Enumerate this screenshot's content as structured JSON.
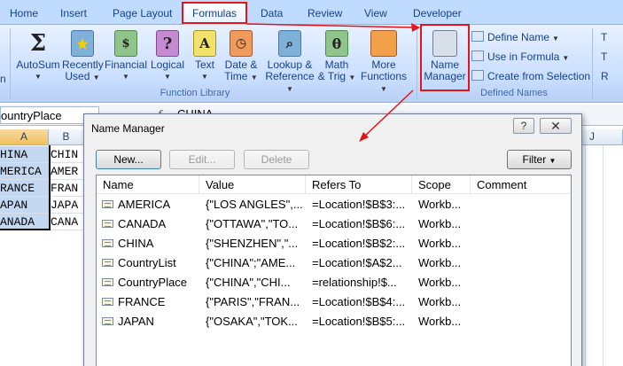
{
  "tabs": [
    "Home",
    "Insert",
    "Page Layout",
    "Formulas",
    "Data",
    "Review",
    "View",
    "Developer"
  ],
  "ribbon": {
    "partial_left": "n",
    "function_library": {
      "buttons": [
        {
          "line1": "AutoSum",
          "line2": "",
          "icon": "sigma-icon"
        },
        {
          "line1": "Recently",
          "line2": "Used",
          "icon": "star-book-icon"
        },
        {
          "line1": "Financial",
          "line2": "",
          "icon": "money-book-icon"
        },
        {
          "line1": "Logical",
          "line2": "",
          "icon": "question-book-icon"
        },
        {
          "line1": "Text",
          "line2": "",
          "icon": "text-book-icon"
        },
        {
          "line1": "Date &",
          "line2": "Time",
          "icon": "clock-book-icon"
        },
        {
          "line1": "Lookup &",
          "line2": "Reference",
          "icon": "magnifier-book-icon"
        },
        {
          "line1": "Math",
          "line2": "& Trig",
          "icon": "theta-book-icon"
        },
        {
          "line1": "More",
          "line2": "Functions",
          "icon": "more-books-icon"
        }
      ],
      "label": "Function Library"
    },
    "defined_names": {
      "name_manager_line1": "Name",
      "name_manager_line2": "Manager",
      "define_name": "Define Name",
      "use_in_formula": "Use in Formula",
      "create_from_selection": "Create from Selection",
      "label": "Defined Names"
    },
    "partial_right": [
      "T",
      "T",
      "R"
    ]
  },
  "formula_bar": {
    "name_box": "ountryPlace",
    "fx": "f",
    "value": "CHINA"
  },
  "sheet": {
    "col_a": "A",
    "col_b": "B",
    "col_j": "J",
    "col_a_cells": [
      "HINA",
      "MERICA",
      "RANCE",
      "APAN",
      "ANADA"
    ],
    "col_b_cells": [
      "CHIN",
      "AMER",
      "FRAN",
      "JAPA",
      "CANA"
    ]
  },
  "dialog": {
    "title": "Name Manager",
    "help": "?",
    "close": "✕",
    "new_button": "New...",
    "edit_button": "Edit...",
    "delete_button": "Delete",
    "filter_button": "Filter",
    "columns": [
      "Name",
      "Value",
      "Refers To",
      "Scope",
      "Comment"
    ],
    "rows": [
      {
        "name": "AMERICA",
        "value": "{\"LOS ANGLES\",...",
        "refers_to": "=Location!$B$3:...",
        "scope": "Workb...",
        "comment": ""
      },
      {
        "name": "CANADA",
        "value": "{\"OTTAWA\",\"TO...",
        "refers_to": "=Location!$B$6:...",
        "scope": "Workb...",
        "comment": ""
      },
      {
        "name": "CHINA",
        "value": "{\"SHENZHEN\",\"...",
        "refers_to": "=Location!$B$2:...",
        "scope": "Workb...",
        "comment": ""
      },
      {
        "name": "CountryList",
        "value": "{\"CHINA\";\"AME...",
        "refers_to": "=Location!$A$2...",
        "scope": "Workb...",
        "comment": ""
      },
      {
        "name": "CountryPlace",
        "value": "{\"CHINA\",\"CHI...",
        "refers_to": "=relationship!$...",
        "scope": "Workb...",
        "comment": ""
      },
      {
        "name": "FRANCE",
        "value": "{\"PARIS\",\"FRAN...",
        "refers_to": "=Location!$B$4:...",
        "scope": "Workb...",
        "comment": ""
      },
      {
        "name": "JAPAN",
        "value": "{\"OSAKA\",\"TOK...",
        "refers_to": "=Location!$B$5:...",
        "scope": "Workb...",
        "comment": ""
      }
    ]
  },
  "colors": {
    "highlight": "#e4141b",
    "ribbon_blue": "#bfdbff",
    "text_blue": "#15428b"
  }
}
